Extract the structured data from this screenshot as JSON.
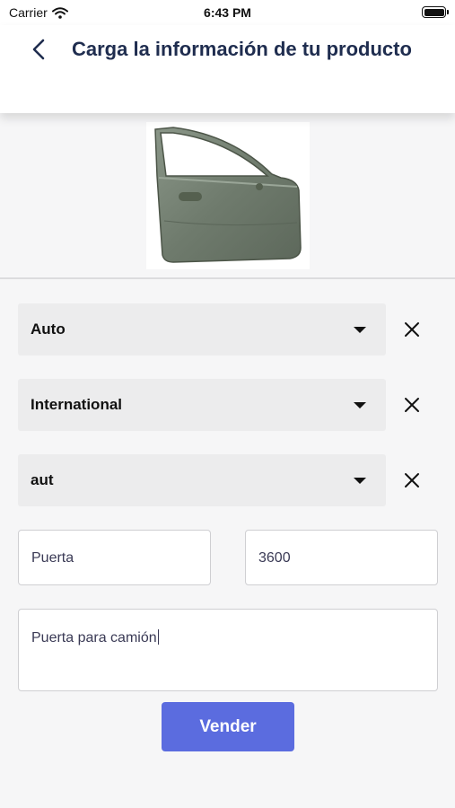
{
  "status_bar": {
    "carrier": "Carrier",
    "time": "6:43 PM"
  },
  "header": {
    "title": "Carga la información de tu producto",
    "back_icon": "chevron-left-icon",
    "title_color": "#1f2d4f"
  },
  "product_image": {
    "icon": "car-door-image"
  },
  "form": {
    "selects": [
      {
        "value": "Auto"
      },
      {
        "value": "International"
      },
      {
        "value": "aut"
      }
    ],
    "clear_icon": "close-icon",
    "name_value": "Puerta",
    "price_value": "3600",
    "description_value": "Puerta para camión",
    "submit_label": "Vender",
    "submit_color": "#5b6cdf"
  }
}
